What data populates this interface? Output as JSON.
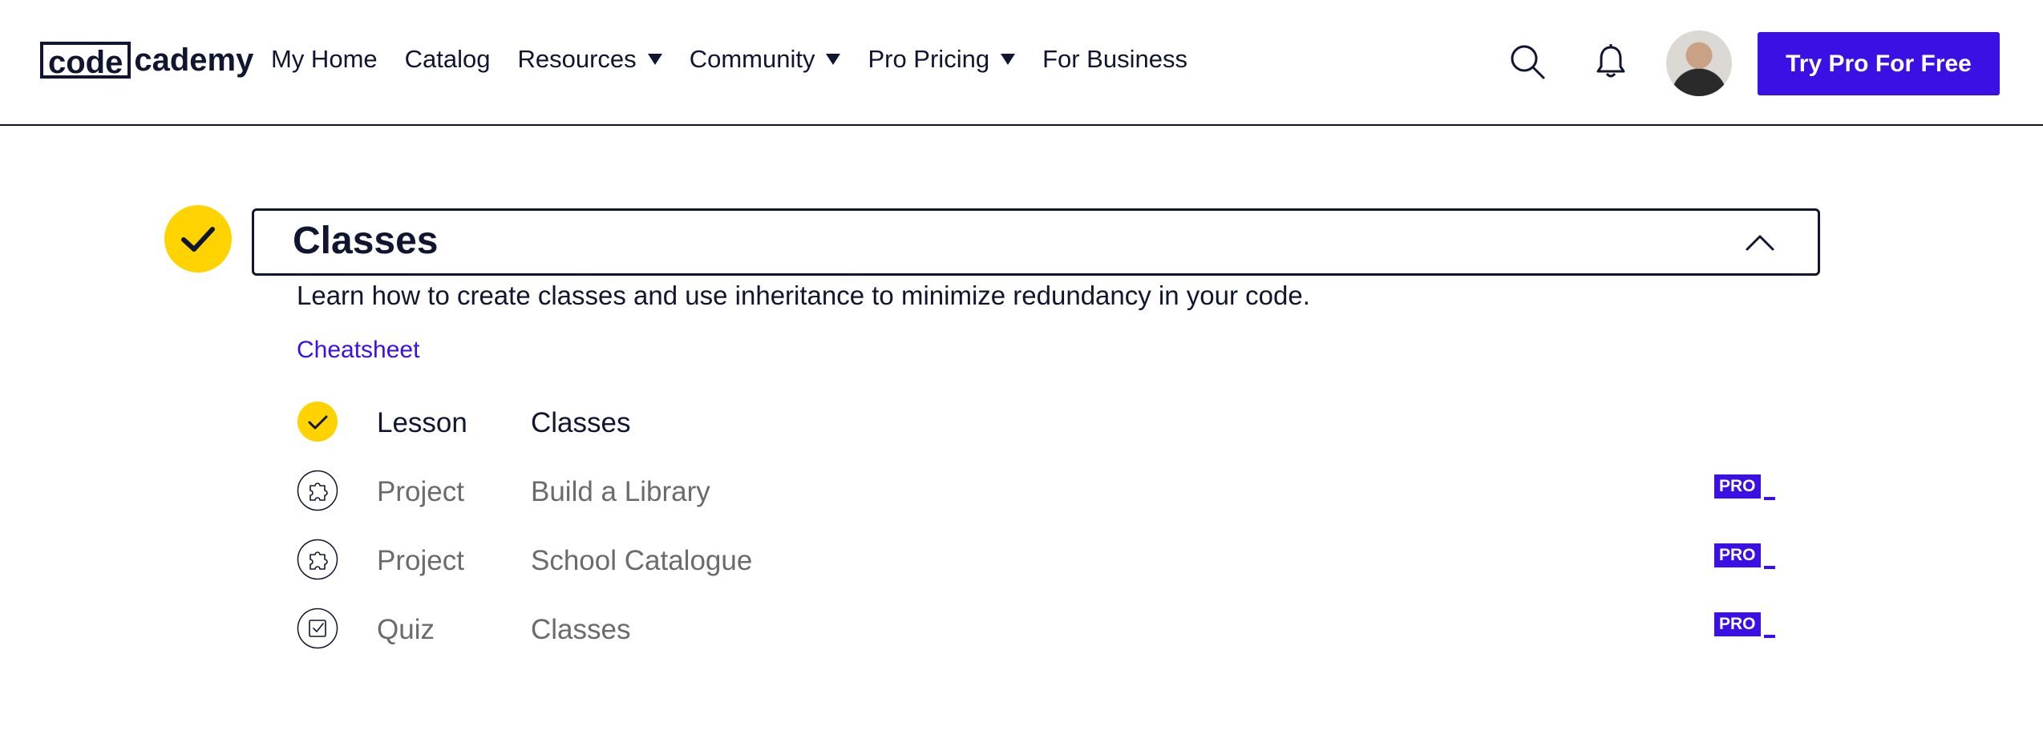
{
  "header": {
    "logo_part1": "code",
    "logo_part2": "cademy",
    "nav": [
      {
        "label": "My Home"
      },
      {
        "label": "Catalog"
      },
      {
        "label": "Resources"
      },
      {
        "label": "Community"
      },
      {
        "label": "Pro Pricing"
      },
      {
        "label": "For Business"
      }
    ],
    "icons": [
      "search-icon",
      "bell-icon"
    ],
    "cta_label": "Try Pro For Free"
  },
  "module": {
    "title": "Classes",
    "status": "completed",
    "expanded": true,
    "description": "Learn how to create classes and use inheritance to minimize redundancy in your code.",
    "cheatsheet_label": "Cheatsheet",
    "items": [
      {
        "type": "Lesson",
        "name": "Classes",
        "icon": "check-icon",
        "completed": true,
        "pro": ""
      },
      {
        "type": "Project",
        "name": "Build a Library",
        "icon": "puzzle-icon",
        "completed": false,
        "pro": "PRO"
      },
      {
        "type": "Project",
        "name": "School Catalogue",
        "icon": "puzzle-icon",
        "completed": false,
        "pro": "PRO"
      },
      {
        "type": "Quiz",
        "name": "Classes",
        "icon": "quiz-icon",
        "completed": false,
        "pro": "PRO"
      }
    ]
  },
  "colors": {
    "brand_navy": "#10162f",
    "accent_purple": "#3a10e5",
    "complete_yellow": "#ffd300"
  }
}
